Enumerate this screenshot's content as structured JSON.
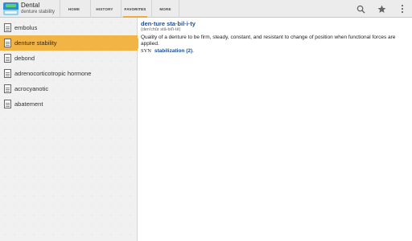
{
  "app": {
    "title": "Dental",
    "subtitle": "denture stability"
  },
  "tabs": [
    {
      "label": "HOME"
    },
    {
      "label": "HISTORY"
    },
    {
      "label": "FAVORITES"
    },
    {
      "label": "MORE"
    }
  ],
  "actions": {
    "search_icon": "search-icon",
    "star_icon": "star-icon",
    "overflow_icon": "more-vert-icon"
  },
  "favorites": [
    {
      "label": "embolus"
    },
    {
      "label": "denture stability"
    },
    {
      "label": "debond"
    },
    {
      "label": "adrenocorticotropic hormone"
    },
    {
      "label": "acrocyanotic"
    },
    {
      "label": "abatement"
    }
  ],
  "selected_index": 1,
  "entry": {
    "headword": "den·ture sta·bil·i·ty",
    "pronunciation": "(den'chŭr stă-bil'i-tē)",
    "definition": "Quality of a denture to be firm, steady, constant, and resistant to change of position when functional forces are applied.",
    "syn_label": "SYN",
    "syn_link": "stabilization (2)",
    "syn_tail": "."
  },
  "colors": {
    "accent": "#f3b446",
    "link": "#1f4e8c"
  }
}
